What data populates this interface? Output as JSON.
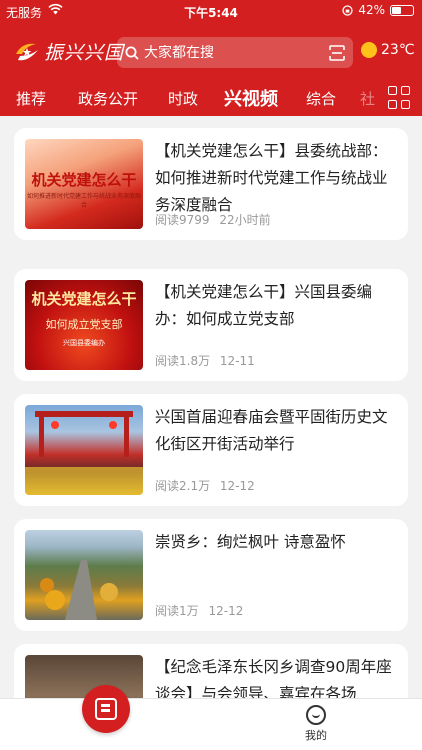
{
  "status_bar": {
    "carrier": "无服务",
    "time": "下午5:44",
    "battery": "42%"
  },
  "header": {
    "logo_text": "振兴兴国",
    "search_placeholder": "大家都在搜",
    "temperature": "23℃"
  },
  "tabs": [
    {
      "label": "推荐",
      "active": false
    },
    {
      "label": "政务公开",
      "active": false
    },
    {
      "label": "时政",
      "active": false
    },
    {
      "label": "兴视频",
      "active": true
    },
    {
      "label": "综合",
      "active": false
    },
    {
      "label": "社",
      "active": false
    }
  ],
  "articles": [
    {
      "title": "【机关党建怎么干】县委统战部：如何推进新时代党建工作与统战业务深度融合",
      "reads": "阅读9799",
      "time": "22小时前",
      "thumb_big": "机关党建怎么干",
      "thumb_small": "如何推进新时代党建工作与统战业务深度融合"
    },
    {
      "title": "【机关党建怎么干】兴国县委编办：如何成立党支部",
      "reads": "阅读1.8万",
      "time": "12-11",
      "thumb_big": "机关党建怎么干",
      "thumb_mid": "如何成立党支部",
      "thumb_small": "兴国县委编办"
    },
    {
      "title": "兴国首届迎春庙会暨平固街历史文化街区开街活动举行",
      "reads": "阅读2.1万",
      "time": "12-12"
    },
    {
      "title": "崇贤乡：绚烂枫叶 诗意盈怀",
      "reads": "阅读1万",
      "time": "12-12"
    },
    {
      "title": "【纪念毛泽东长冈乡调查90周年座谈会】与会领导、嘉宾在各场",
      "reads": "",
      "time": ""
    }
  ],
  "tabbar": {
    "me_label": "我的"
  },
  "colors": {
    "brand_red": "#d31f1f",
    "sun": "#ffc21a"
  }
}
